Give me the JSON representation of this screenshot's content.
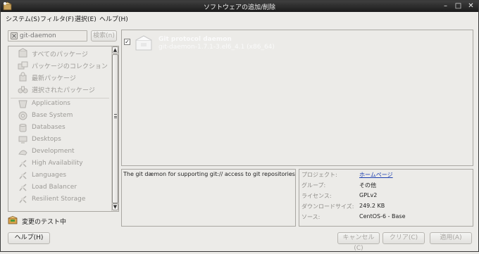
{
  "window": {
    "title": "ソフトウェアの追加/削除",
    "minimize": "–",
    "maximize": "□",
    "close": "✕"
  },
  "menubar": [
    "システム(S)",
    "フィルタ(F)",
    "選択(E)",
    "ヘルプ(H)"
  ],
  "search": {
    "value": "git-daemon",
    "button": "検索(n)"
  },
  "sidebar": {
    "groups": [
      "すべてのパッケージ",
      "パッケージのコレクション",
      "最新パッケージ",
      "選択されたパッケージ"
    ],
    "categories": [
      "Applications",
      "Base System",
      "Databases",
      "Desktops",
      "Development",
      "High Availability",
      "Languages",
      "Load Balancer",
      "Resilient Storage"
    ]
  },
  "status": {
    "label": "変更のテスト中"
  },
  "package": {
    "checked": "✓",
    "name": "Git protocol daemon",
    "version": "git-daemon-1.7.1-3.el6_4.1 (x86_64)"
  },
  "description": "The git dæmon for supporting git:// access to git repositories",
  "details": {
    "project_label": "プロジェクト:",
    "project_value": "ホームページ",
    "group_label": "グループ:",
    "group_value": "その他",
    "license_label": "ライセンス:",
    "license_value": "GPLv2",
    "size_label": "ダウンロードサイズ:",
    "size_value": "249.2 KB",
    "source_label": "ソース:",
    "source_value": "CentOS-6 - Base"
  },
  "buttons": {
    "help": "ヘルプ(H)",
    "cancel": "キャンセル(C)",
    "clear": "クリア(C)",
    "apply": "適用(A)"
  }
}
